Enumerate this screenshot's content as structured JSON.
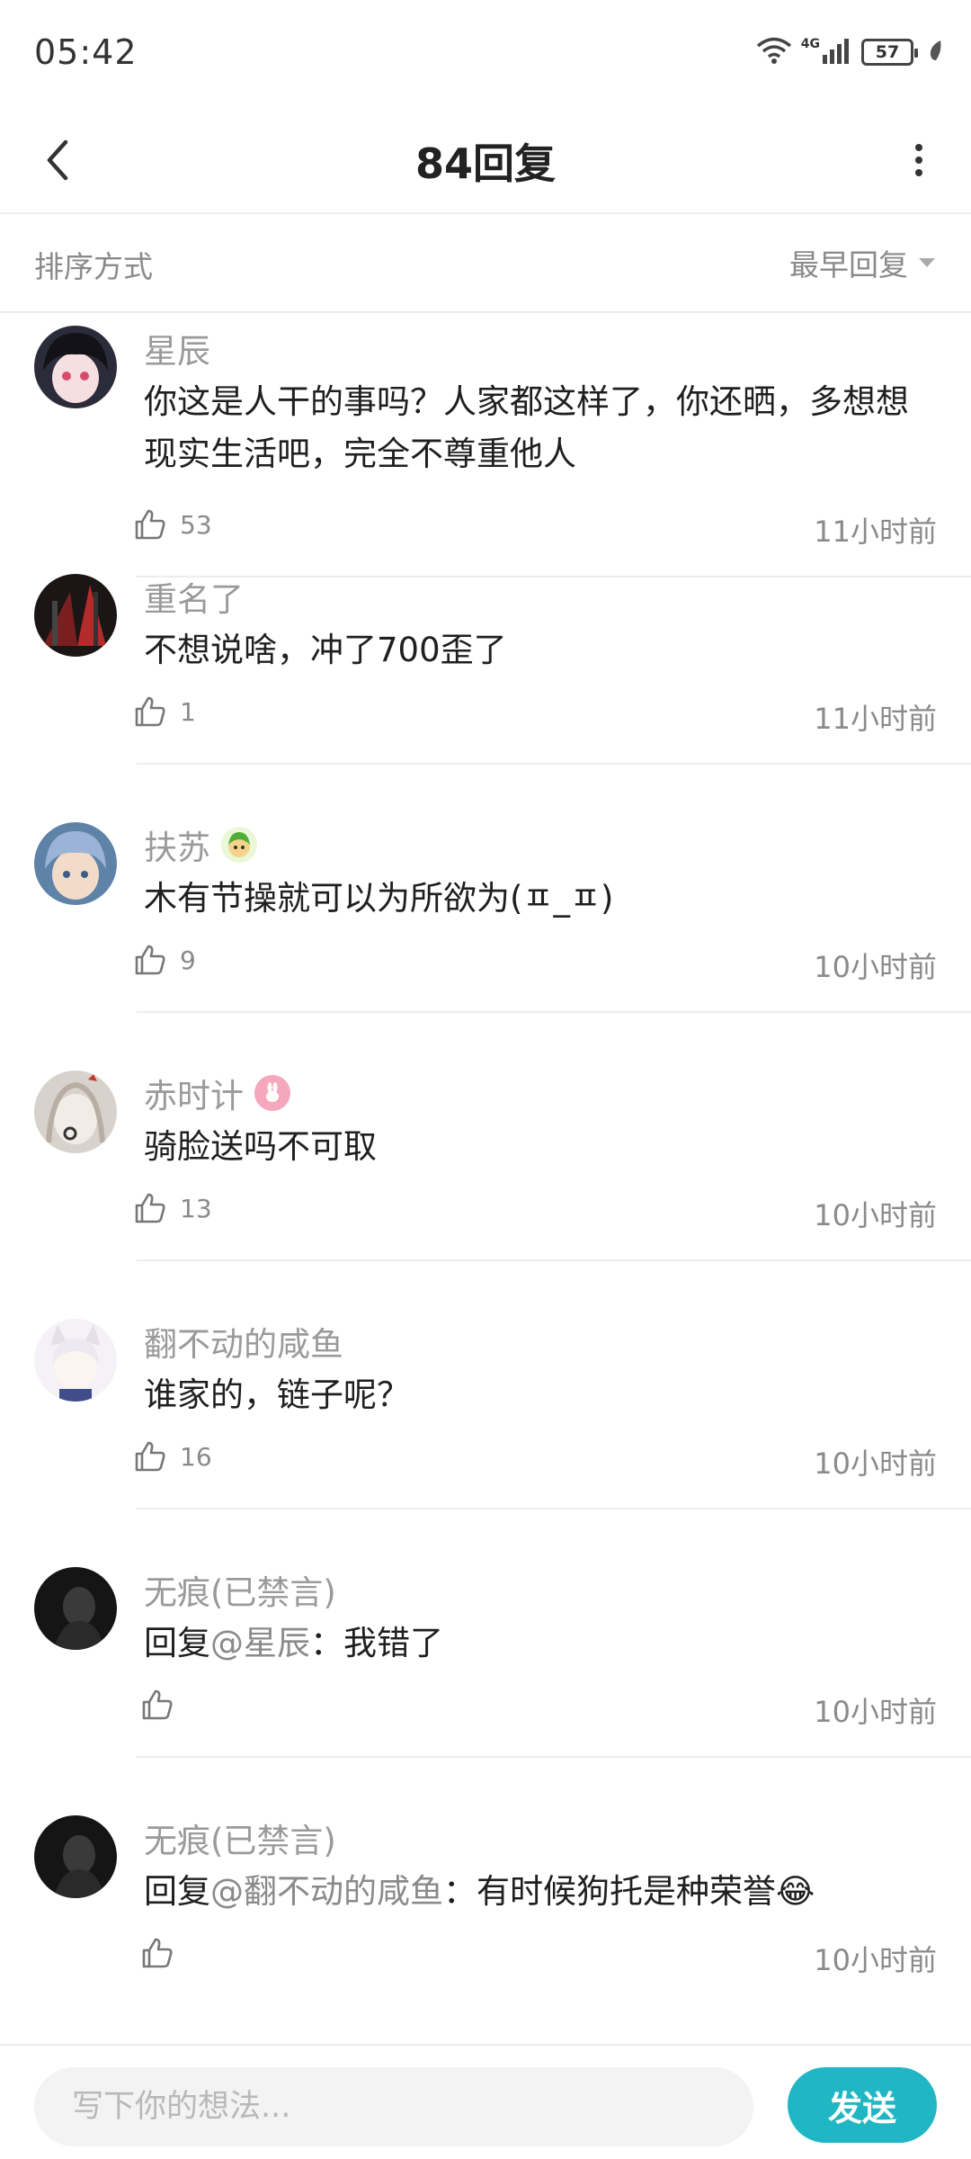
{
  "status_bar": {
    "time": "05:42",
    "network": "4G",
    "battery": "57"
  },
  "header": {
    "title": "84回复"
  },
  "sort": {
    "label": "排序方式",
    "value": "最早回复"
  },
  "comments": [
    {
      "username": "星辰",
      "avatar_color": "#2b2b3a",
      "content": "你这是人干的事吗？人家都这样了，你还晒，多想想现实生活吧，完全不尊重他人",
      "likes": "53",
      "time": "11小时前"
    },
    {
      "username": "重名了",
      "avatar_color": "#3a1d1d",
      "content": "不想说啥，冲了700歪了",
      "likes": "1",
      "time": "11小时前"
    },
    {
      "username": "扶苏",
      "avatar_color": "#5f83a8",
      "badge": "green-character-badge",
      "content": "木有节操就可以为所欲为(ㅍ_ㅍ)",
      "likes": "9",
      "time": "10小时前"
    },
    {
      "username": "赤时计",
      "avatar_color": "#c9bfb7",
      "badge": "pink-rabbit-badge",
      "content": "骑脸送吗不可取",
      "likes": "13",
      "time": "10小时前"
    },
    {
      "username": "翻不动的咸鱼",
      "avatar_color": "#e9e6ef",
      "content": "谁家的，链子呢？",
      "likes": "16",
      "time": "10小时前"
    },
    {
      "username": "无痕(已禁言)",
      "avatar_color": "#1e1e1e",
      "reply_prefix": "回复",
      "mention": "@星辰",
      "content": "：我错了",
      "likes": "",
      "time": "10小时前"
    },
    {
      "username": "无痕(已禁言)",
      "avatar_color": "#1e1e1e",
      "reply_prefix": "回复",
      "mention": "@翻不动的咸鱼",
      "content": "：有时候狗托是种荣誉😂",
      "likes": "",
      "time": "10小时前"
    }
  ],
  "input": {
    "placeholder": "写下你的想法..."
  },
  "send_button": {
    "label": "发送"
  },
  "colors": {
    "accent": "#21b6c4",
    "muted_text": "#8a8a8a"
  }
}
